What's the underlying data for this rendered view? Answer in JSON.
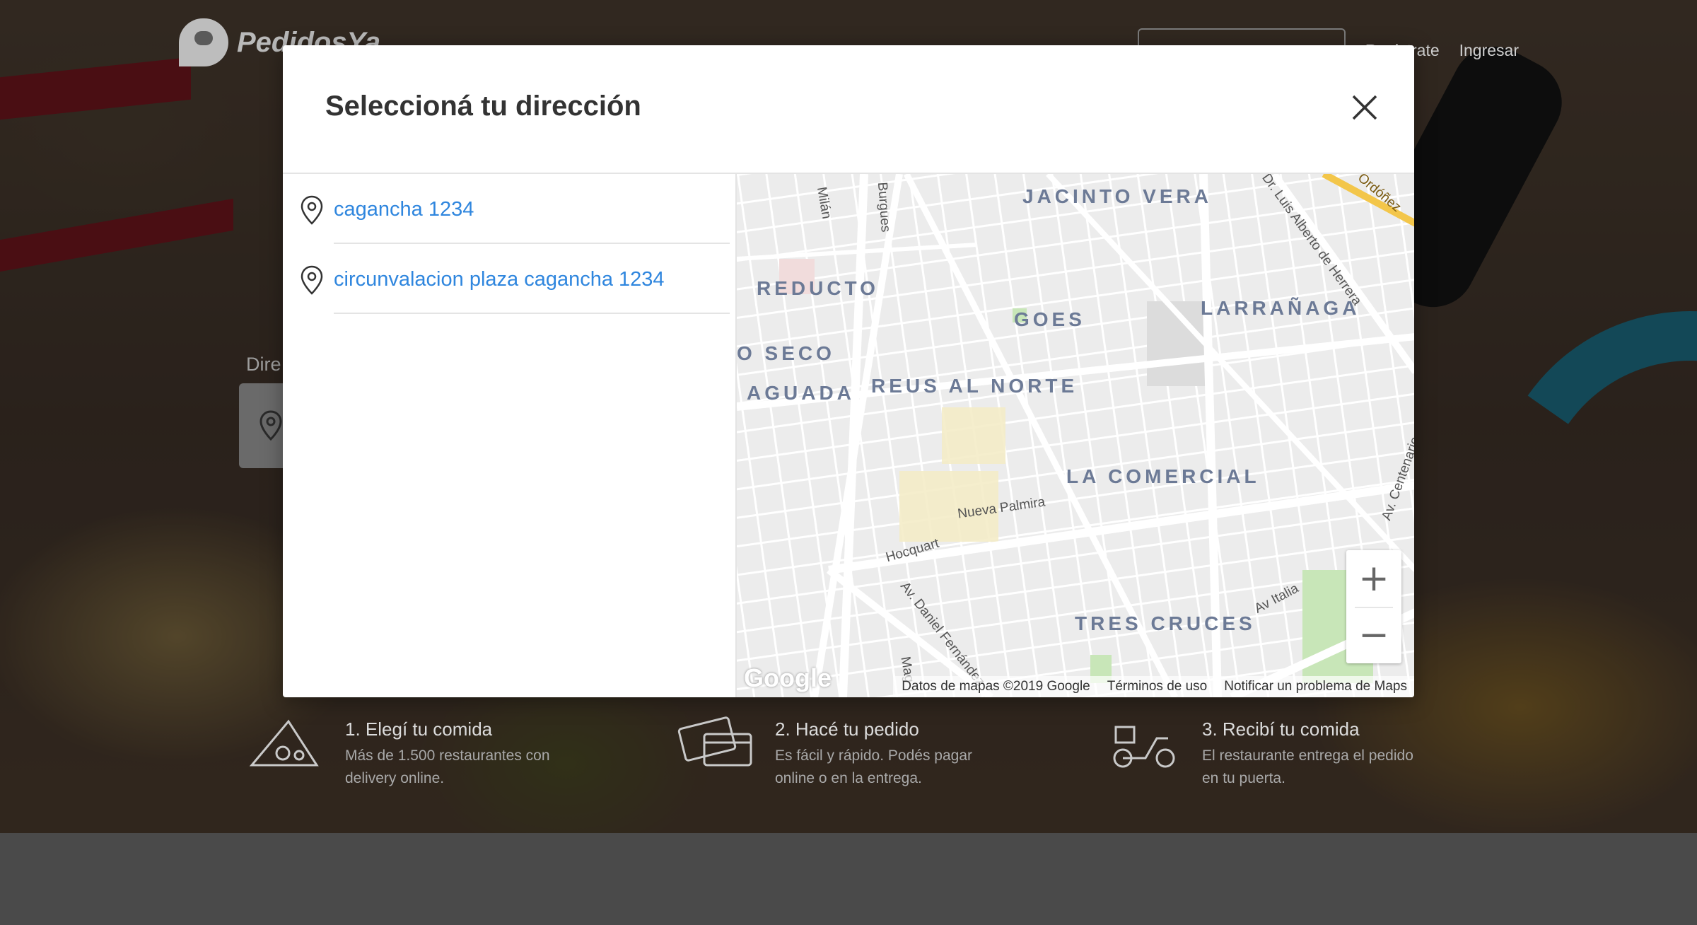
{
  "header": {
    "brand": "PedidosYa",
    "nav": {
      "mid_link": "Registrate",
      "login_link": "Ingresar"
    }
  },
  "hero": {
    "address_label_visible": "Dire"
  },
  "steps": [
    {
      "title": "1. Elegí tu comida",
      "desc": "Más de 1.500 restaurantes con delivery online."
    },
    {
      "title": "2. Hacé tu pedido",
      "desc": "Es fácil y rápido. Podés pagar online o en la entrega."
    },
    {
      "title": "3. Recibí tu comida",
      "desc": "El restaurante entrega el pedido en tu puerta."
    }
  ],
  "modal": {
    "title": "Seleccioná tu dirección",
    "addresses": [
      {
        "text": "cagancha 1234"
      },
      {
        "text": "circunvalacion plaza cagancha 1234"
      }
    ]
  },
  "map": {
    "neighborhoods": [
      "JACINTO VERA",
      "REDUCTO",
      "GOES",
      "LARRAÑAGA",
      "O SECO",
      "AGUADA",
      "REUS AL NORTE",
      "LA COMERCIAL",
      "TRES CRUCES"
    ],
    "streets": [
      "Milán",
      "Burgues",
      "Dr. Luis Alberto de Herrera",
      "Ordóñez",
      "Nueva Palmira",
      "Hocquart",
      "Av. Daniel Fernández",
      "Av Italia",
      "Av. Centenario",
      "Mag"
    ],
    "zoom_in": "+",
    "zoom_out": "−",
    "google_logo": "Google",
    "footer": {
      "data": "Datos de mapas ©2019 Google",
      "terms": "Términos de uso",
      "report": "Notificar un problema de Maps"
    }
  },
  "colors": {
    "link_blue": "#2f86de",
    "neighborhood_label": "#6c7a96",
    "overlay": "rgba(0,0,0,0.55)"
  }
}
